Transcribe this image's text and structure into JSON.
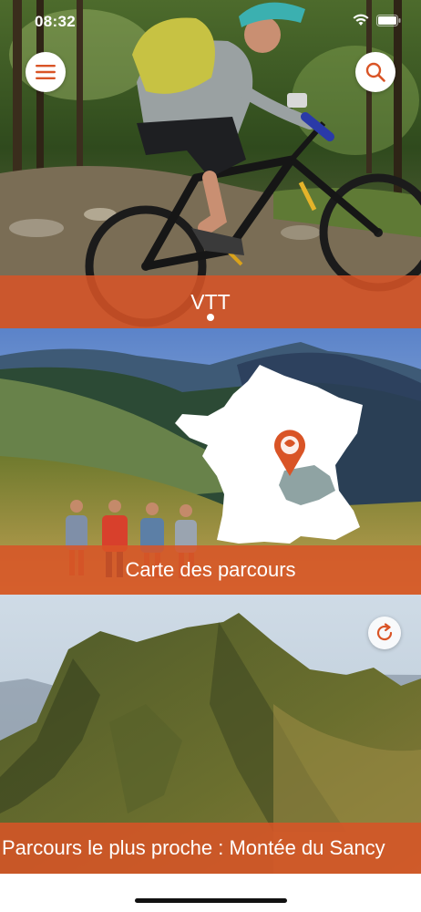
{
  "status_bar": {
    "time": "08:32"
  },
  "carousel": {
    "title": "VTT",
    "page_count": 1,
    "current_page": 1
  },
  "map_card": {
    "label": "Carte des parcours"
  },
  "nearest_card": {
    "label": "Parcours le plus proche : Montée du Sancy"
  },
  "icons": {
    "menu": "menu-icon",
    "search": "search-icon",
    "refresh": "refresh-icon",
    "marker": "location-marker-icon"
  },
  "colors": {
    "accent": "#D95426",
    "banner": "rgba(217,84,38,0.86)",
    "highlight_region": "#8fa3a3"
  }
}
